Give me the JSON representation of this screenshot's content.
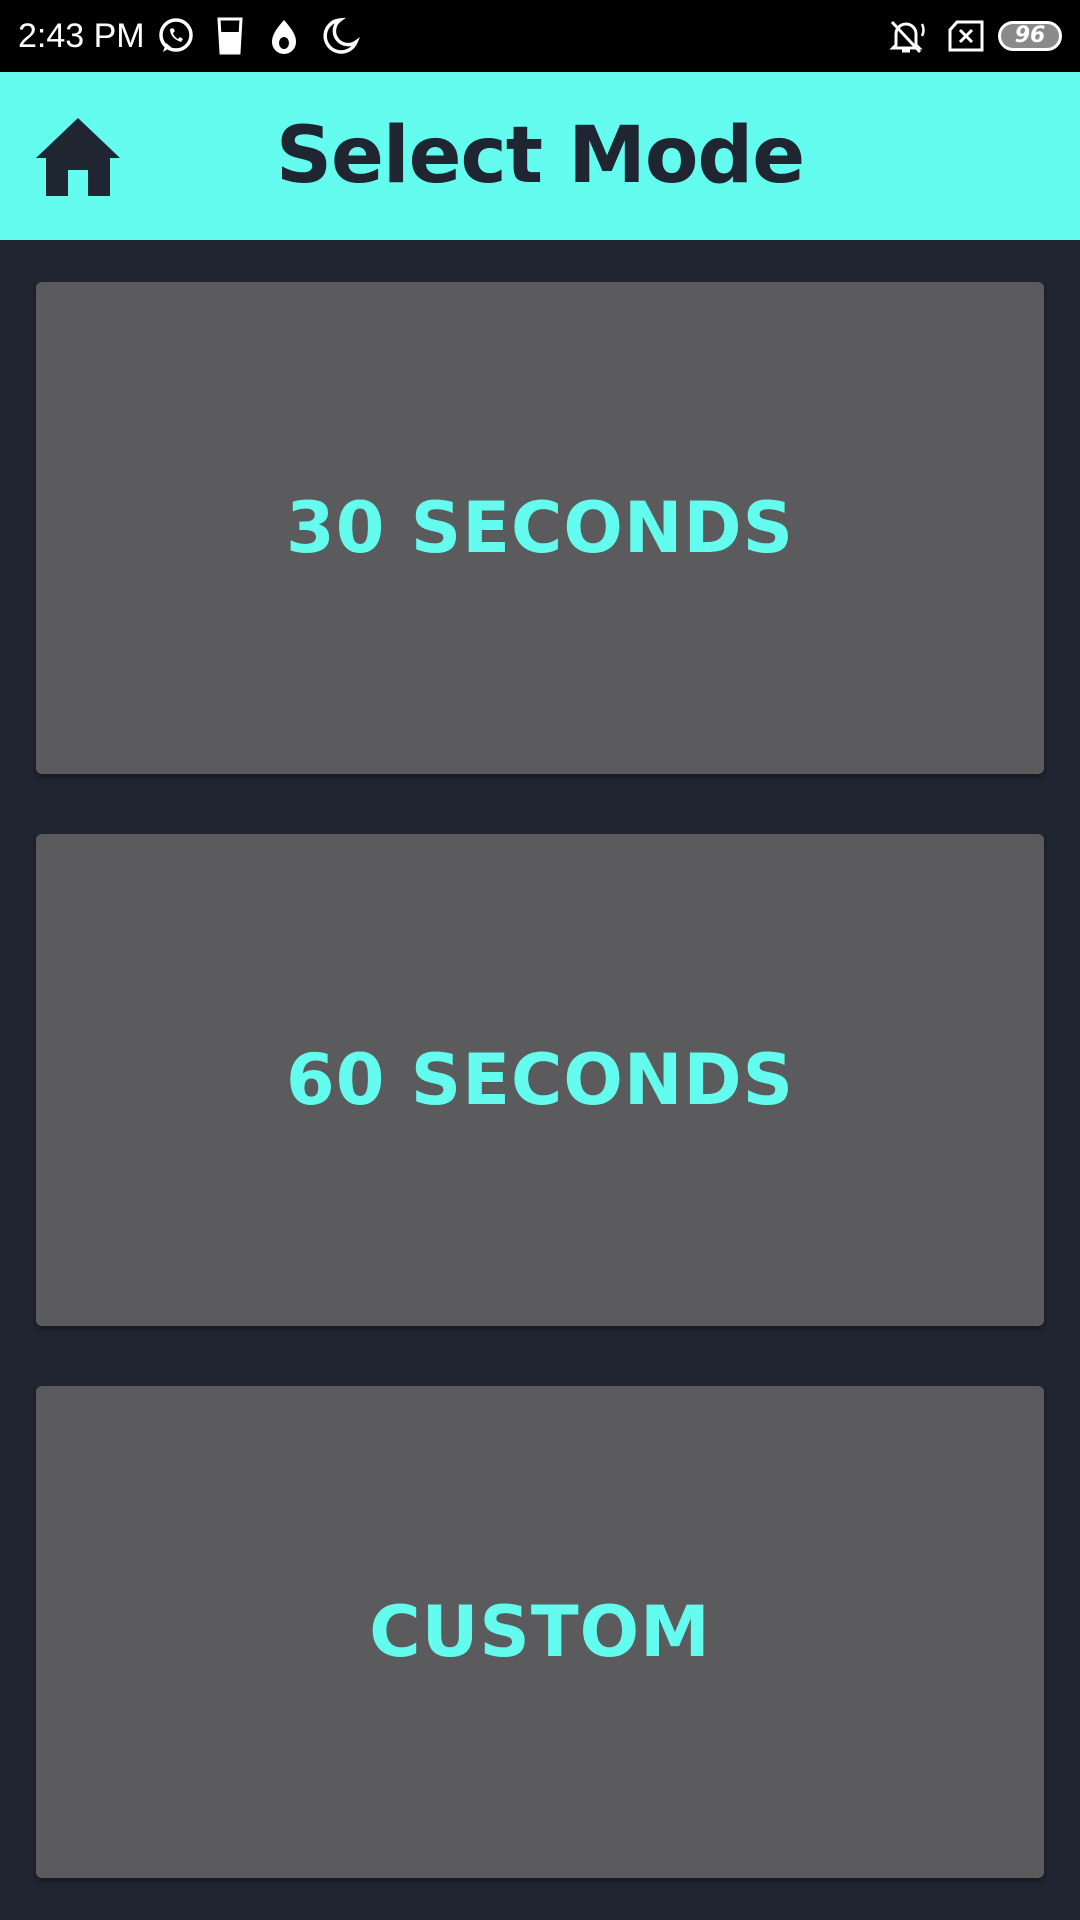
{
  "status_bar": {
    "time": "2:43 PM",
    "battery": "96",
    "icons": [
      "whatsapp-icon",
      "glass-icon",
      "drop-icon",
      "moon-icon",
      "bell-muted-icon",
      "sim-x-icon",
      "battery-icon"
    ]
  },
  "header": {
    "title": "Select Mode",
    "home_icon": "home-icon"
  },
  "modes": [
    {
      "label": "30 SECONDS"
    },
    {
      "label": "60 SECONDS"
    },
    {
      "label": "CUSTOM"
    }
  ],
  "colors": {
    "accent": "#64fcee",
    "background": "#1f2531",
    "card": "#5b5b5e",
    "status_bar": "#000000"
  }
}
